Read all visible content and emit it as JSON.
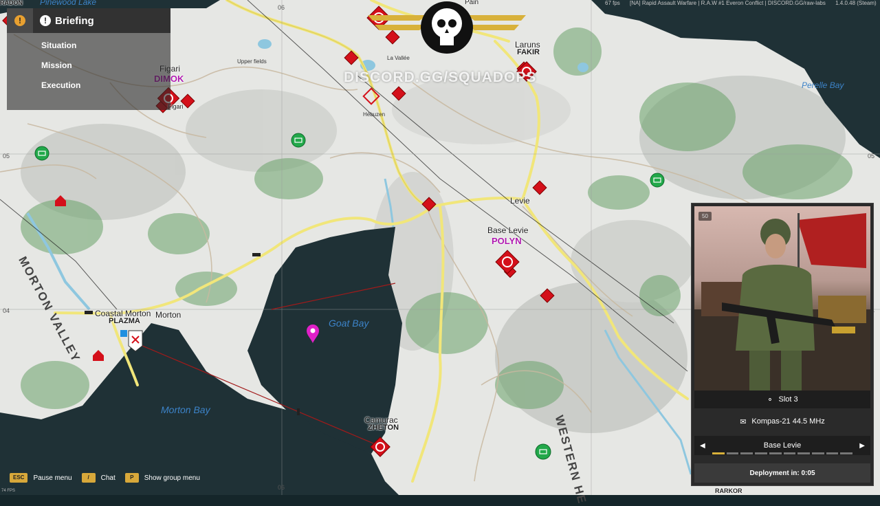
{
  "topbar": {
    "fps": "67 fps",
    "server": "[NA] Rapid Assault Warfare | R.A.W #1 Everon Conflict | DISCORD.GG/raw-labs",
    "version": "1.4.0.48 (Steam)"
  },
  "briefing": {
    "title": "Briefing",
    "items": [
      "Situation",
      "Mission",
      "Execution"
    ]
  },
  "map": {
    "watermark": "DISCORD.GG/SQUADOPS",
    "grid_labels": [
      "06",
      "05",
      "04",
      "05",
      "04",
      "06"
    ],
    "places": [
      {
        "name": "Pinewood Lake",
        "cls": "water"
      },
      {
        "name": "RADON",
        "cls": "code-dark"
      },
      {
        "name": "Figari",
        "cls": "town"
      },
      {
        "name": "DIMOK",
        "cls": "code"
      },
      {
        "name": "Figari",
        "cls": "town"
      },
      {
        "name": "Laruns",
        "cls": "town"
      },
      {
        "name": "FAKIR",
        "cls": "code-dark"
      },
      {
        "name": "Perelle Bay",
        "cls": "water"
      },
      {
        "name": "Levie",
        "cls": "town"
      },
      {
        "name": "Base Levie",
        "cls": "town"
      },
      {
        "name": "POLYN",
        "cls": "code"
      },
      {
        "name": "Coastal Morton",
        "cls": "town"
      },
      {
        "name": "PLAZMA",
        "cls": "code-dark"
      },
      {
        "name": "Morton",
        "cls": "town"
      },
      {
        "name": "Goat Bay",
        "cls": "water"
      },
      {
        "name": "Morton Bay",
        "cls": "water"
      },
      {
        "name": "Camurac",
        "cls": "town"
      },
      {
        "name": "ZHETON",
        "cls": "code-dark"
      },
      {
        "name": "MORTON VALLEY",
        "cls": "valley"
      },
      {
        "name": "WESTERN HE",
        "cls": "valley"
      },
      {
        "name": "RARKOR",
        "cls": "code-dark"
      },
      {
        "name": "Upper fields",
        "cls": "small"
      },
      {
        "name": "La Vallée",
        "cls": "small"
      },
      {
        "name": "Hébuzen",
        "cls": "small"
      },
      {
        "name": "Pain",
        "cls": "town"
      }
    ]
  },
  "panel": {
    "ammo": "50",
    "slot": "Slot 3",
    "radio": "Kompas-21 44.5 MHz",
    "spawn": "Base Levie",
    "deploy": "Deployment in: 0:05",
    "progress": 0.1
  },
  "hints": [
    {
      "key": "ESC",
      "label": "Pause menu"
    },
    {
      "key": "/",
      "label": "Chat"
    },
    {
      "key": "P",
      "label": "Show group menu"
    }
  ],
  "fps_left": "74 FPS",
  "colors": {
    "accent": "#d8a83a",
    "enemy": "#d4101a",
    "friendly": "#22a84a",
    "objective": "#e020c8"
  }
}
